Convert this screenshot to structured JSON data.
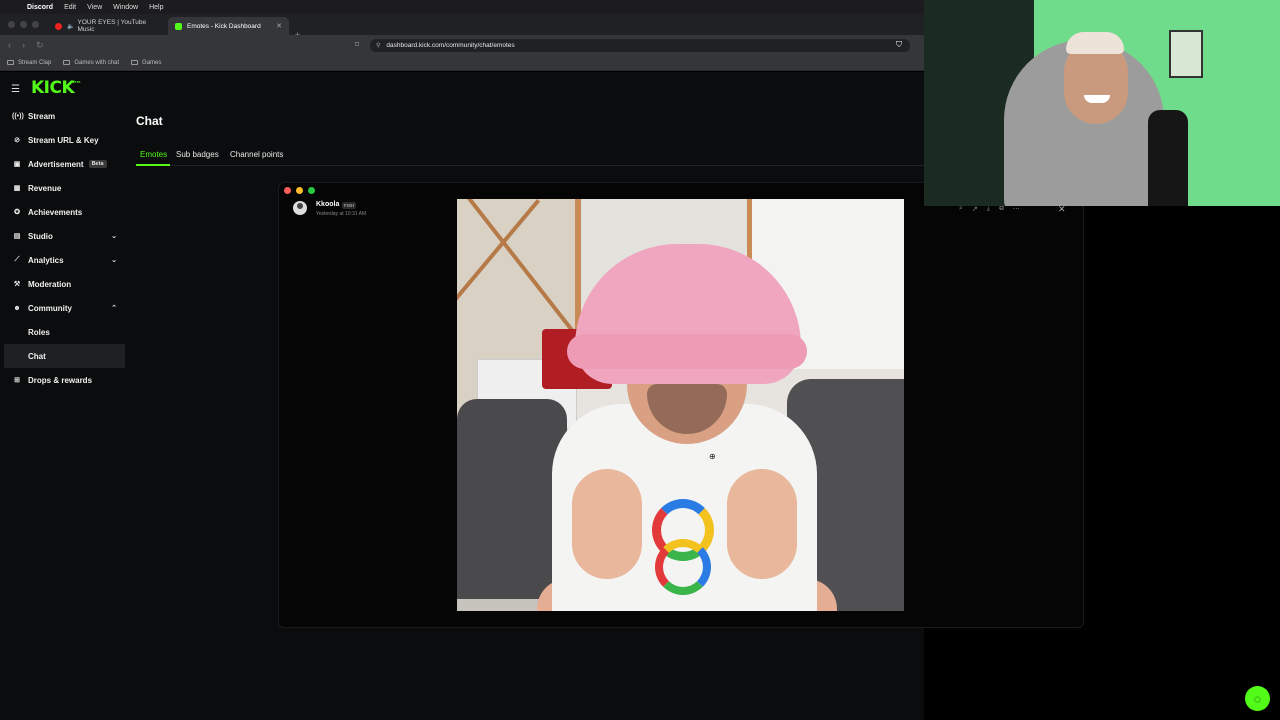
{
  "menubar": {
    "app": "Discord",
    "items": [
      "Edit",
      "View",
      "Window",
      "Help"
    ]
  },
  "browser": {
    "tabs": [
      {
        "label": "YOUR EYES | YouTube Music",
        "active": false
      },
      {
        "label": "Emotes - Kick Dashboard",
        "active": true
      }
    ],
    "url": "dashboard.kick.com/community/chat/emotes",
    "bookmarks": [
      "Stream Clap",
      "Games with chat",
      "Games"
    ]
  },
  "sidebar": {
    "logo": "KICK",
    "logo_badge": "BETA",
    "items": [
      {
        "label": "Stream",
        "icon": "broadcast-icon"
      },
      {
        "label": "Stream URL & Key",
        "icon": "link-icon"
      },
      {
        "label": "Advertisement",
        "icon": "ad-icon",
        "badge": "Beta"
      },
      {
        "label": "Revenue",
        "icon": "revenue-icon"
      },
      {
        "label": "Achievements",
        "icon": "trophy-icon"
      },
      {
        "label": "Studio",
        "icon": "studio-icon",
        "expandable": true
      },
      {
        "label": "Analytics",
        "icon": "analytics-icon",
        "expandable": true
      },
      {
        "label": "Moderation",
        "icon": "hammer-icon"
      },
      {
        "label": "Community",
        "icon": "community-icon",
        "expanded": true
      },
      {
        "label": "Roles",
        "sub": true
      },
      {
        "label": "Chat",
        "sub": true,
        "selected": true
      },
      {
        "label": "Drops & rewards",
        "icon": "gift-icon"
      }
    ]
  },
  "main": {
    "title": "Chat",
    "tabs": [
      "Emotes",
      "Sub badges",
      "Channel points"
    ],
    "active_tab": "Emotes"
  },
  "viewer": {
    "author": "Kkoola",
    "author_tag": "FISH",
    "timestamp": "Yesterday at 10:31 AM"
  },
  "colors": {
    "accent": "#53fc18",
    "background": "#0b0c0d"
  }
}
